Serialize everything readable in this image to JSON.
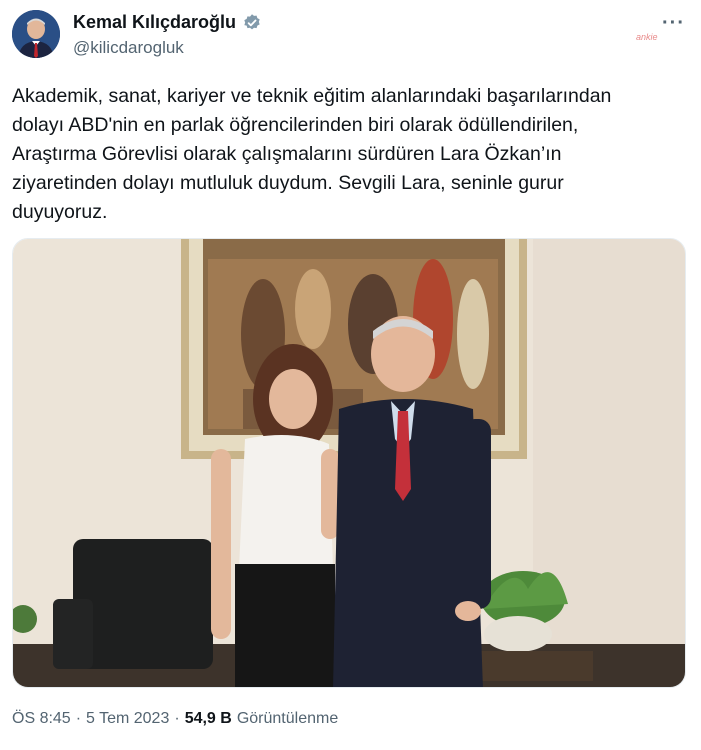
{
  "author": {
    "name": "Kemal Kılıçdaroğlu",
    "handle": "@kilicdarogluk",
    "avatar_icon": "profile-avatar",
    "verified_icon": "verified-badge-icon",
    "verified_color": "#829aab"
  },
  "menu": {
    "more_label": "···"
  },
  "watermark": {
    "text": "ankie"
  },
  "tweet": {
    "lines": [
      "Akademik, sanat, kariyer ve teknik eğitim alanlarındaki başarılarından",
      "dolayı ABD'nin en parlak öğrencilerinden biri olarak ödüllendirilen,",
      "Araştırma Görevlisi olarak çalışmalarını sürdüren Lara Özkan’ın",
      "ziyaretinden dolayı mutluluk duydum. Sevgili Lara, seninle gurur",
      "duyuyoruz."
    ]
  },
  "media": {
    "description_icon": "photo-image"
  },
  "meta": {
    "time": "ÖS 8:45",
    "sep1": "·",
    "date": "5 Tem 2023",
    "sep2": "·",
    "views_count": "54,9 B",
    "views_label": "Görüntülenme"
  }
}
